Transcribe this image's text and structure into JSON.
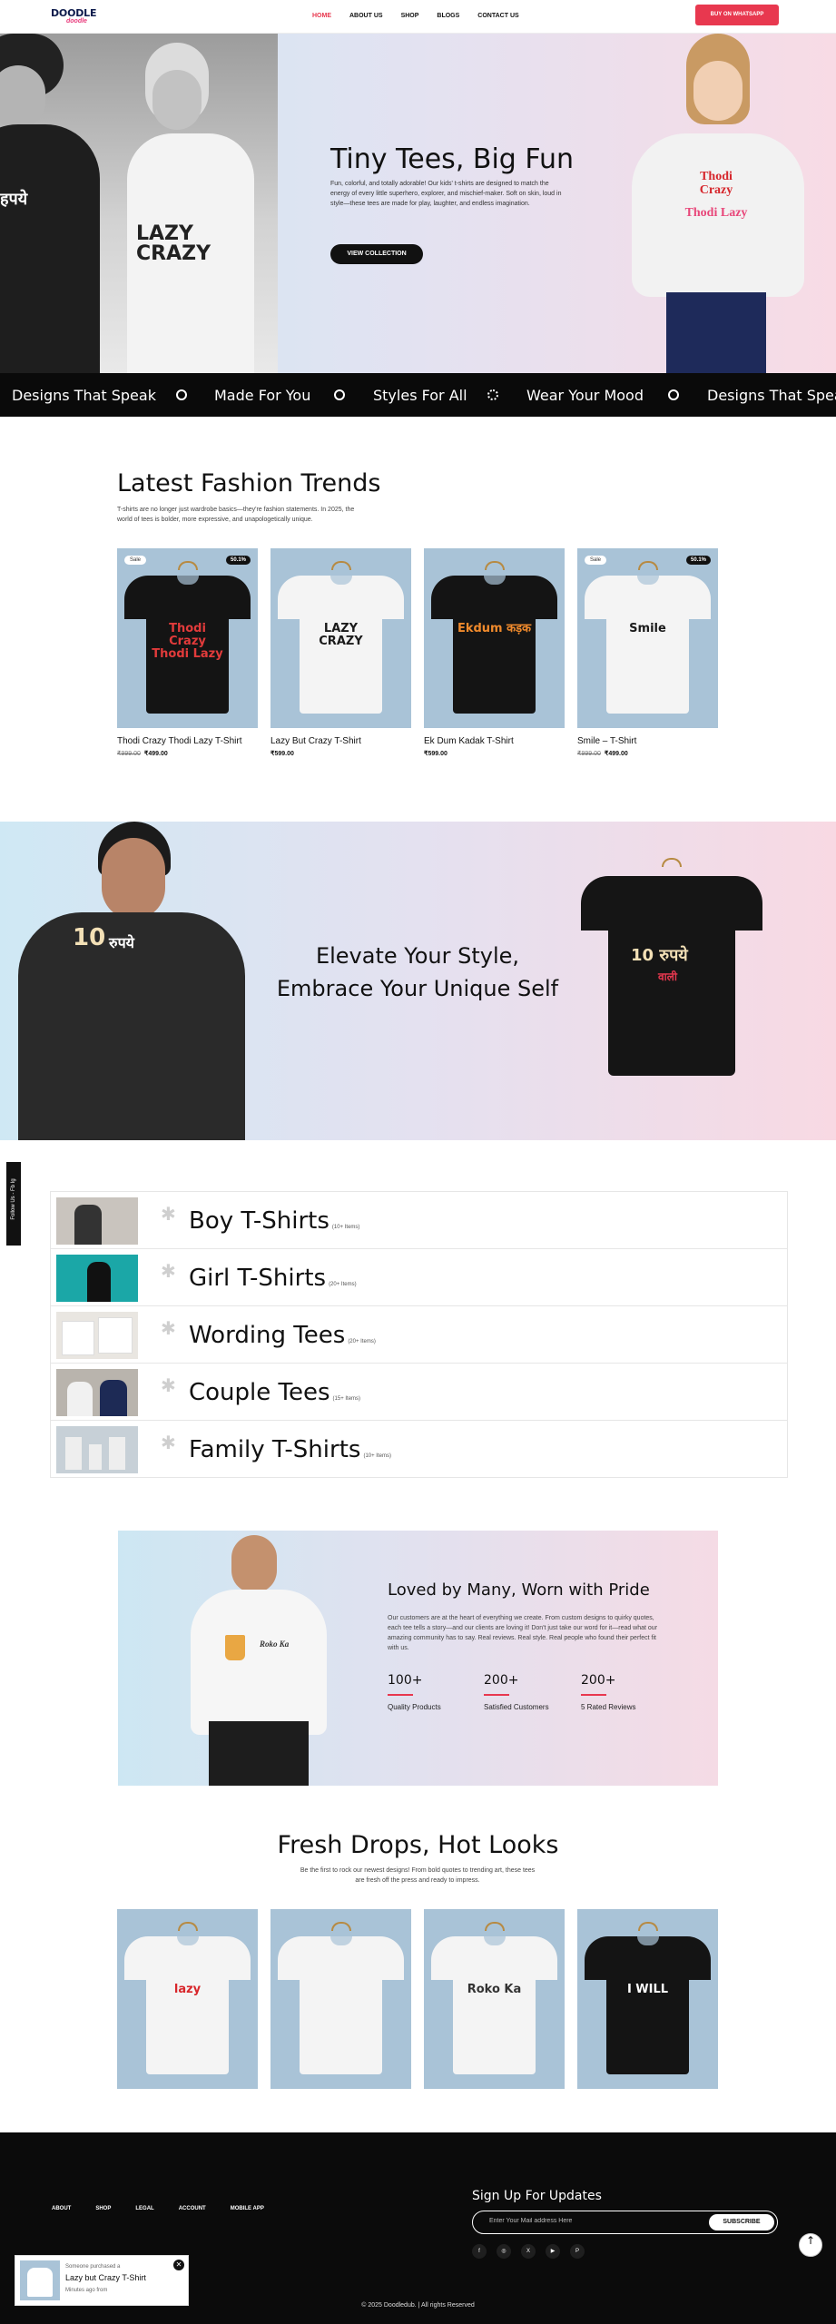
{
  "header": {
    "logo_top": "DOODLE",
    "logo_bottom": "doodle",
    "nav": [
      "HOME",
      "ABOUT US",
      "SHOP",
      "BLOGS",
      "CONTACT US"
    ],
    "cta": "BUY ON WHATSAPP",
    "accent": "#e8384f"
  },
  "hero": {
    "title": "Tiny Tees, Big Fun",
    "text": "Fun, colorful, and totally adorable! Our kids' t-shirts are designed to match the energy of every little superhero, explorer, and mischief-maker. Soft on skin, loud in style—these tees are made for play, laughter, and endless imagination.",
    "button": "VIEW COLLECTION",
    "left_shirt_text": "LAZY CRAZY",
    "kid_shirt_top": "Thodi Crazy",
    "kid_shirt_bottom": "Thodi Lazy"
  },
  "marquee": [
    "Designs That Speak",
    "Made For You",
    "Styles For All",
    "Wear Your Mood",
    "Designs That Spea"
  ],
  "trends": {
    "title": "Latest Fashion Trends",
    "subtitle": "T-shirts are no longer just wardrobe basics—they're fashion statements. In 2025, the world of tees is bolder, more expressive, and unapologetically unique.",
    "products": [
      {
        "name": "Thodi Crazy Thodi Lazy T-Shirt",
        "old": "₹999.00",
        "new": "₹499.00",
        "sale": "Sale",
        "off": "50.1%",
        "shirt": "black",
        "print": "Thodi Crazy Thodi Lazy"
      },
      {
        "name": "Lazy But Crazy T-Shirt",
        "old": "",
        "new": "₹599.00",
        "sale": "",
        "off": "",
        "shirt": "white",
        "print": "LAZY CRAZY"
      },
      {
        "name": "Ek Dum Kadak T-Shirt",
        "old": "",
        "new": "₹599.00",
        "sale": "",
        "off": "",
        "shirt": "black",
        "print": "Ekdum कड़क"
      },
      {
        "name": "Smile – T-Shirt",
        "old": "₹999.00",
        "new": "₹499.00",
        "sale": "Sale",
        "off": "50.1%",
        "shirt": "white",
        "print": "Smile"
      }
    ]
  },
  "banner": {
    "line1": "Elevate Your Style,",
    "line2": "Embrace Your Unique Self",
    "shirt_print_top": "10 रुपये",
    "shirt_print_bottom": "वाली"
  },
  "follow": "Follow Us - Fb Ig",
  "categories": [
    {
      "name": "Boy T-Shirts",
      "count": "(10+ Items)"
    },
    {
      "name": "Girl T-Shirts",
      "count": "(20+ Items)"
    },
    {
      "name": "Wording Tees",
      "count": "(20+ Items)"
    },
    {
      "name": "Couple Tees",
      "count": "(15+ Items)"
    },
    {
      "name": "Family T-Shirts",
      "count": "(10+ Items)"
    }
  ],
  "loved": {
    "title": "Loved by Many, Worn with Pride",
    "text": "Our customers are at the heart of everything we create. From custom designs to quirky quotes, each tee tells a story—and our clients are loving it! Don't just take our word for it—read what our amazing community has to say. Real reviews. Real style. Real people who found their perfect fit with us.",
    "stats": [
      {
        "num": "100+",
        "label": "Quality Products"
      },
      {
        "num": "200+",
        "label": "Satisfied Customers"
      },
      {
        "num": "200+",
        "label": "5 Rated Reviews"
      }
    ],
    "shirt_print": "Roko Ka"
  },
  "fresh": {
    "title": "Fresh Drops, Hot Looks",
    "subtitle": "Be the first to rock our newest designs! From bold quotes to trending art, these tees are fresh off the press and ready to impress.",
    "shirts": [
      {
        "shirt": "white",
        "print": "lazy"
      },
      {
        "shirt": "white",
        "print": ""
      },
      {
        "shirt": "white",
        "print": "Roko Ka"
      },
      {
        "shirt": "black",
        "print": "I WILL"
      }
    ]
  },
  "footer": {
    "links": [
      "ABOUT",
      "SHOP",
      "LEGAL",
      "ACCOUNT",
      "MOBILE APP"
    ],
    "signup_title": "Sign Up For Updates",
    "email_placeholder": "Enter Your Mail address Here",
    "subscribe": "SUBSCRIBE",
    "socials": [
      "f",
      "◎",
      "X",
      "▶",
      "P"
    ],
    "copyright": "© 2025 Doodledub. | All rights Reserved"
  },
  "popup": {
    "line1": "Someone purchased a",
    "product": "Lazy but Crazy T-Shirt",
    "line3": "Minutes ago from",
    "close": "✕"
  },
  "back_to_top": "↑"
}
